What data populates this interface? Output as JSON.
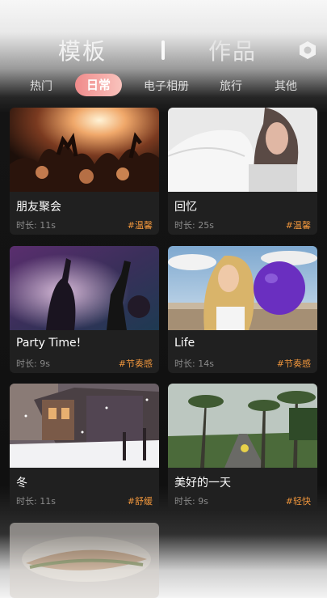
{
  "header": {
    "tab_templates": "模板",
    "tab_works": "作品",
    "settings_icon": "hexagon-settings-icon"
  },
  "categories": [
    "热门",
    "日常",
    "电子相册",
    "旅行",
    "其他"
  ],
  "active_category": "日常",
  "cards": [
    {
      "title": "朋友聚会",
      "duration": "时长: 11s",
      "tag": "#温馨"
    },
    {
      "title": "回忆",
      "duration": "时长: 25s",
      "tag": "#温馨"
    },
    {
      "title": "Party Time!",
      "duration": "时长: 9s",
      "tag": "#节奏感"
    },
    {
      "title": "Life",
      "duration": "时长: 14s",
      "tag": "#节奏感"
    },
    {
      "title": "冬",
      "duration": "时长: 11s",
      "tag": "#舒缓"
    },
    {
      "title": "美好的一天",
      "duration": "时长: 9s",
      "tag": "#轻快"
    }
  ],
  "colors": {
    "accent_pink": "#f08b8b",
    "tag_orange": "#f0963c",
    "card_bg": "#202020"
  }
}
